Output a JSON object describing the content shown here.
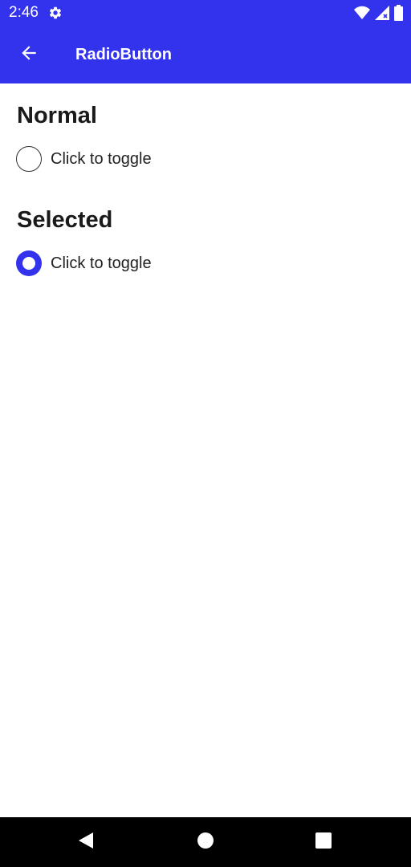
{
  "status_bar": {
    "time": "2:46",
    "icons": [
      "gear-icon",
      "wifi-icon",
      "signal-icon",
      "battery-icon"
    ]
  },
  "app_bar": {
    "title": "RadioButton",
    "back_icon": "arrow-back-icon"
  },
  "sections": [
    {
      "title": "Normal",
      "radio": {
        "label": "Click to toggle",
        "checked": false
      }
    },
    {
      "title": "Selected",
      "radio": {
        "label": "Click to toggle",
        "checked": true
      }
    }
  ],
  "nav_bar": {
    "buttons": [
      "back-triangle-icon",
      "home-circle-icon",
      "recents-square-icon"
    ]
  },
  "colors": {
    "accent": "#3333EE",
    "background": "#FFFFFF",
    "text": "#1A1A1A",
    "nav_background": "#000000"
  }
}
